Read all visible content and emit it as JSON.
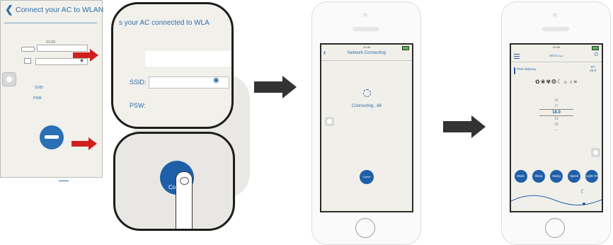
{
  "panel1": {
    "title": "Connect your AC to WLAN",
    "time": "21:09",
    "ssid_label": "SSID:",
    "psw_label": "PSW:",
    "eye": "◉"
  },
  "zoom_top": {
    "title": "s your AC connected to WLA",
    "ssid_label": "SSID:",
    "psw_label": "PSW:",
    "eye": "◉"
  },
  "zoom_bottom": {
    "button_label": "Co"
  },
  "phone2": {
    "status_time": "21:09",
    "title": "Network Connecting",
    "status_text": "Connecting...88",
    "cancel_label": "Cancel",
    "back": "‹"
  },
  "phone3": {
    "status_time": "21:09",
    "title": "2KV2",
    "title_extra": "Sleep",
    "power": "⏻",
    "pm_label": "PM2.5Wiping",
    "rt_label": "RT",
    "rt_value": "25.8",
    "mode_icons": "✿❀✾❂☾☼♁≡",
    "temps": [
      "16",
      "17",
      "18.0",
      "19",
      "20",
      "—"
    ],
    "buttons": [
      "Mode",
      "Sleep",
      "Swing",
      "Speed",
      "Light ON"
    ],
    "moon": "☾"
  },
  "colors": {
    "accent": "#1f5fa8",
    "red_arrow": "#d01f1f",
    "black_arrow": "#333333",
    "screen_bg": "#f1efea"
  }
}
